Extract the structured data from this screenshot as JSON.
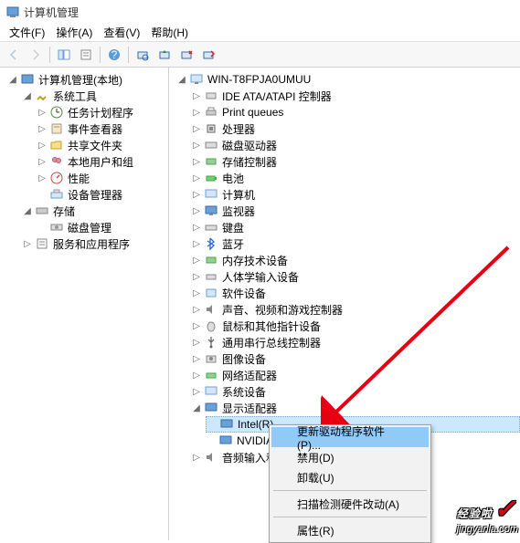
{
  "window": {
    "title": "计算机管理"
  },
  "menu": {
    "file": "文件(F)",
    "action": "操作(A)",
    "view": "查看(V)",
    "help": "帮助(H)"
  },
  "left_tree": {
    "root": "计算机管理(本地)",
    "system_tools": "系统工具",
    "task_scheduler": "任务计划程序",
    "event_viewer": "事件查看器",
    "shared_folders": "共享文件夹",
    "local_users": "本地用户和组",
    "performance": "性能",
    "device_manager": "设备管理器",
    "storage": "存储",
    "disk_management": "磁盘管理",
    "services": "服务和应用程序"
  },
  "right_tree": {
    "root": "WIN-T8FPJA0UMUU",
    "ide": "IDE ATA/ATAPI 控制器",
    "print_queues": "Print queues",
    "processors": "处理器",
    "disk_drives": "磁盘驱动器",
    "storage_controllers": "存储控制器",
    "batteries": "电池",
    "computer": "计算机",
    "monitors": "监视器",
    "keyboards": "键盘",
    "bluetooth": "蓝牙",
    "memory_tech": "内存技术设备",
    "hid": "人体学输入设备",
    "software_devices": "软件设备",
    "sound": "声音、视频和游戏控制器",
    "mice": "鼠标和其他指针设备",
    "usb": "通用串行总线控制器",
    "imaging": "图像设备",
    "network": "网络适配器",
    "system_devices": "系统设备",
    "display": "显示适配器",
    "intel": "Intel(R)",
    "nvidia": "NVIDIA",
    "audio_io": "音频输入和"
  },
  "context_menu": {
    "update_driver": "更新驱动程序软件(P)...",
    "disable": "禁用(D)",
    "uninstall": "卸载(U)",
    "scan": "扫描检测硬件改动(A)",
    "properties": "属性(R)"
  },
  "watermark": {
    "main": "经验啦",
    "url": "jingyanla.com"
  }
}
